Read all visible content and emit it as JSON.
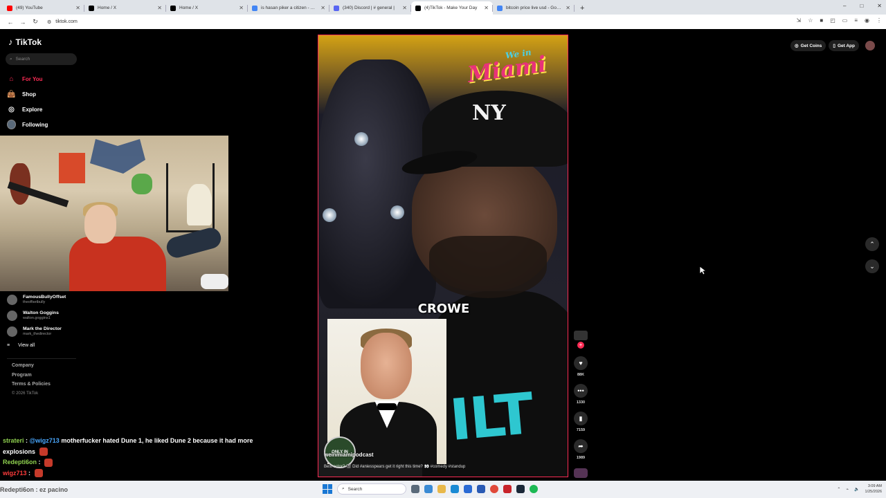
{
  "browser": {
    "tabs": [
      {
        "title": "(49) YouTube",
        "fav": "#ff0000"
      },
      {
        "title": "Home / X",
        "fav": "#000000"
      },
      {
        "title": "Home / X",
        "fav": "#000000"
      },
      {
        "title": "is hasan piker a citizen - Goog",
        "fav": "#4285f4"
      },
      {
        "title": "(340) Discord | # general | ",
        "fav": "#5865f2"
      },
      {
        "title": "(4)TikTok - Make Your Day",
        "fav": "#000000"
      },
      {
        "title": "bitcoin price live usd - Google",
        "fav": "#4285f4"
      }
    ],
    "active_tab_index": 5,
    "url": "tiktok.com"
  },
  "tiktok": {
    "logo": "TikTok",
    "search_placeholder": "Search",
    "nav": [
      {
        "label": "For You",
        "icon": "home-icon",
        "active": true
      },
      {
        "label": "Shop",
        "icon": "shop-bag-icon"
      },
      {
        "label": "Explore",
        "icon": "compass-icon"
      },
      {
        "label": "Following",
        "icon": "following-avatar-icon"
      }
    ],
    "following_accounts": [
      {
        "name": "FamousBullyOffset",
        "handle": "theoffsetbully"
      },
      {
        "name": "Walton Goggins",
        "handle": "walton.goggins1"
      },
      {
        "name": "Mark the Director",
        "handle": "mark_thedirector"
      }
    ],
    "view_all": "View all",
    "footer": [
      "Company",
      "Program",
      "Terms & Policies"
    ],
    "copyright": "© 2026 TikTok",
    "top_right": {
      "coins": "Get Coins",
      "app": "Get App"
    },
    "video": {
      "overlay_brand_small": "We in",
      "overlay_brand": "Miami",
      "cap_logo": "NY",
      "caption": "CROWE",
      "shirt_text": "ILT",
      "badge_text": "ONLY IN",
      "username": "weinmiamipodcast",
      "description": "Best actor? 🎬 Did #aniesspears get it right this time? 👀 #comedy #standup"
    },
    "actions": {
      "likes": "88K",
      "comments": "1330",
      "saves": "7159",
      "shares": "1989"
    }
  },
  "chat": [
    {
      "user": "strateri",
      "mention": "@wigz713",
      "text": "motherfucker hated Dune 1, he liked Dune 2 because it had more explosions"
    },
    {
      "user": "Redepti6on",
      "text": ""
    },
    {
      "user": "wigz713",
      "text": ""
    }
  ],
  "taskbar": {
    "ticker": "Redepti6on : ez pacino",
    "search": "Search",
    "time": "3:09 AM",
    "date": "1/25/2026"
  }
}
